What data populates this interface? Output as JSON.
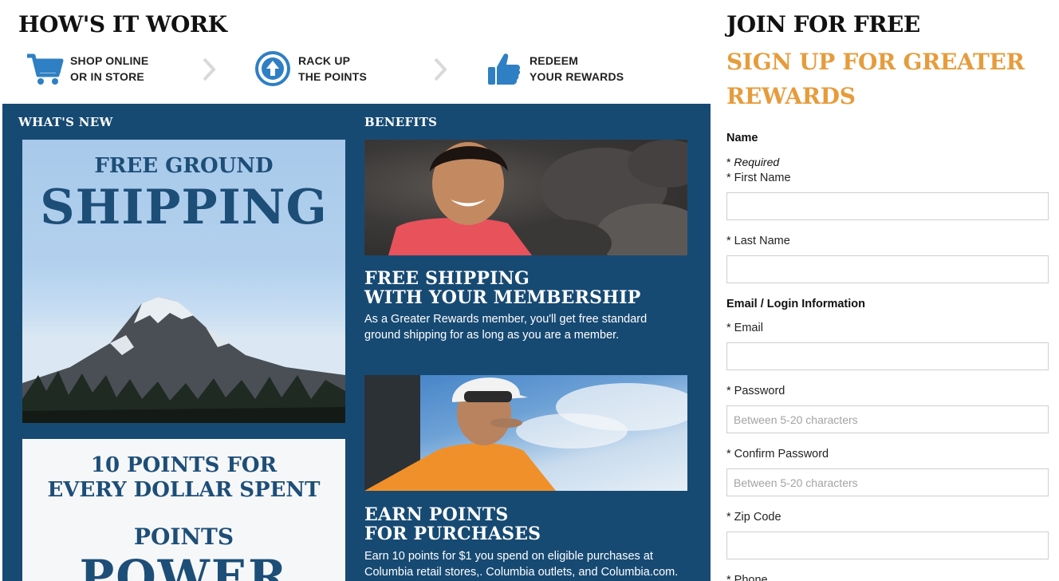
{
  "how": {
    "title": "HOW'S IT WORK",
    "steps": [
      {
        "line1": "SHOP ONLINE",
        "line2": "OR IN STORE",
        "icon": "shopping-cart-icon"
      },
      {
        "line1": "RACK UP",
        "line2": "THE POINTS",
        "icon": "arrow-up-circle-icon"
      },
      {
        "line1": "REDEEM",
        "line2": "YOUR REWARDS",
        "icon": "thumbs-up-icon"
      }
    ]
  },
  "panel": {
    "whats_new": "WHAT'S NEW",
    "benefits": "BENEFITS",
    "shipping_card": {
      "small": "FREE GROUND",
      "big": "SHIPPING"
    },
    "points_card": {
      "line1": "10 POINTS FOR",
      "line2": "EVERY DOLLAR SPENT",
      "sub": "POINTS",
      "power": "POWER"
    },
    "benefit_items": [
      {
        "title1": "FREE SHIPPING",
        "title2": "WITH YOUR MEMBERSHIP",
        "text1": "As a Greater Rewards member, you'll get free standard",
        "text2": "ground shipping for as long as you are a member."
      },
      {
        "title1": "EARN POINTS",
        "title2": "FOR PURCHASES",
        "text1": "Earn 10 points for $1 you spend on eligible purchases at",
        "text2": "Columbia retail stores,. Columbia outlets, and Columbia.com."
      }
    ]
  },
  "signup": {
    "join": "JOIN FOR FREE",
    "headline": "SIGN UP FOR GREATER REWARDS",
    "name_section": "Name",
    "required_star": "* ",
    "required": "Required",
    "first_name_label": "* First Name",
    "last_name_label": "* Last Name",
    "login_section": "Email / Login Information",
    "email_label": "* Email",
    "password_label": "* Password",
    "password_placeholder": "Between 5-20 characters",
    "confirm_label": "* Confirm Password",
    "confirm_placeholder": "Between 5-20 characters",
    "zip_label": "* Zip Code",
    "phone_label": "* Phone"
  },
  "colors": {
    "panel_blue": "#174a73",
    "accent_orange": "#e69c3c",
    "icon_blue": "#2f7fc4"
  }
}
